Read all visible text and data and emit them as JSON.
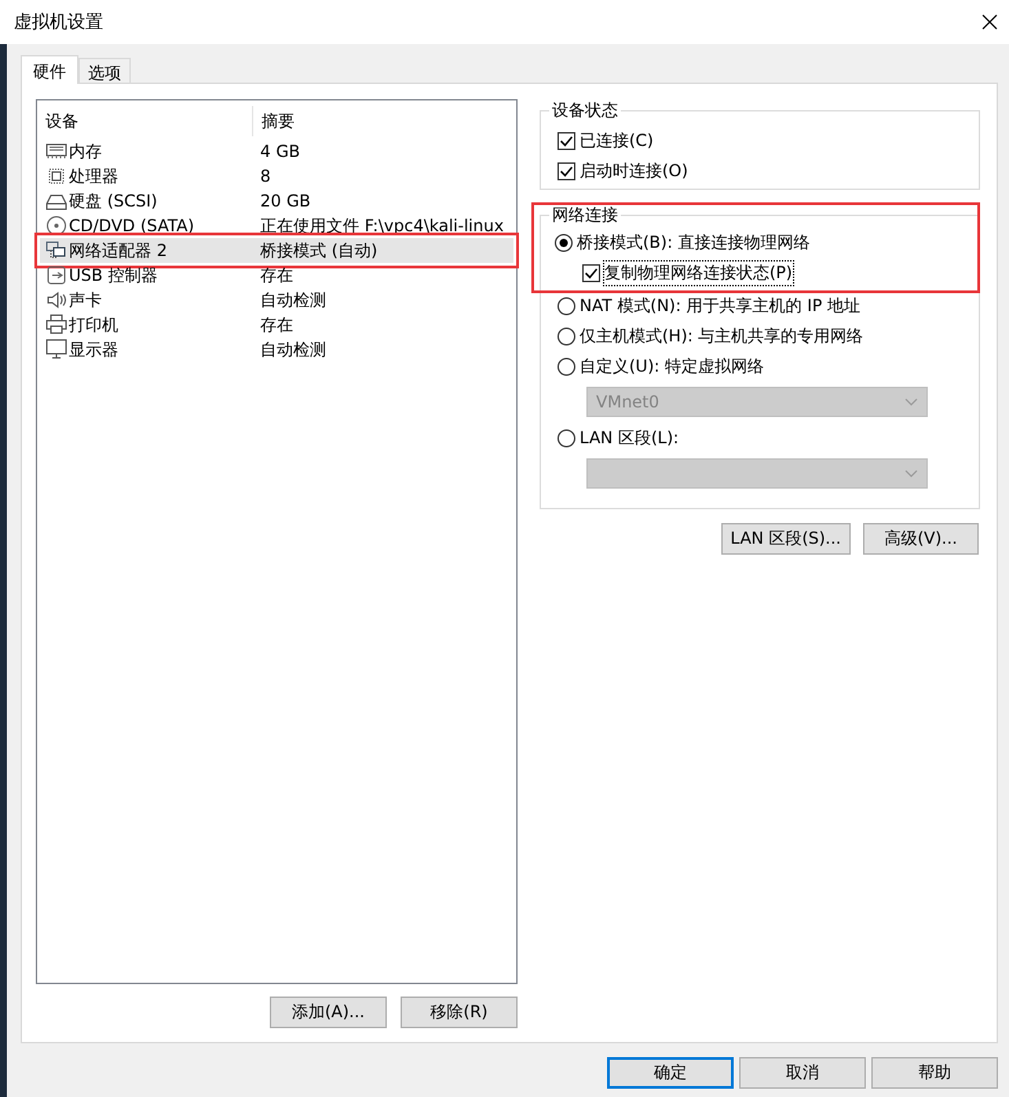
{
  "window": {
    "title": "虚拟机设置"
  },
  "tabs": [
    {
      "label": "硬件",
      "selected": true
    },
    {
      "label": "选项",
      "selected": false
    }
  ],
  "device_table": {
    "columns": [
      "设备",
      "摘要"
    ],
    "rows": [
      {
        "kind": "memory",
        "device": "内存",
        "summary": "4 GB",
        "selected": false,
        "annotated": false
      },
      {
        "kind": "cpu",
        "device": "处理器",
        "summary": "8",
        "selected": false,
        "annotated": false
      },
      {
        "kind": "disk",
        "device": "硬盘 (SCSI)",
        "summary": "20 GB",
        "selected": false,
        "annotated": false
      },
      {
        "kind": "cdrom",
        "device": "CD/DVD (SATA)",
        "summary": "正在使用文件 F:\\vpc4\\kali-linux",
        "selected": false,
        "annotated": false
      },
      {
        "kind": "network",
        "device": "网络适配器 2",
        "summary": "桥接模式 (自动)",
        "selected": true,
        "annotated": true
      },
      {
        "kind": "usb",
        "device": "USB 控制器",
        "summary": "存在",
        "selected": false,
        "annotated": false
      },
      {
        "kind": "sound",
        "device": "声卡",
        "summary": "自动检测",
        "selected": false,
        "annotated": false
      },
      {
        "kind": "printer",
        "device": "打印机",
        "summary": "存在",
        "selected": false,
        "annotated": false
      },
      {
        "kind": "display",
        "device": "显示器",
        "summary": "自动检测",
        "selected": false,
        "annotated": false
      }
    ]
  },
  "device_buttons": [
    "添加(A)...",
    "移除(R)"
  ],
  "device_status": {
    "title": "设备状态",
    "options": [
      {
        "label": "已连接(C)",
        "checked": true
      },
      {
        "label": "启动时连接(O)",
        "checked": true
      }
    ]
  },
  "network_connection": {
    "title": "网络连接",
    "annotated": true,
    "modes": [
      {
        "label": "桥接模式(B): 直接连接物理网络",
        "selected": true,
        "sub_option": {
          "label": "复制物理网络连接状态(P)",
          "checked": true,
          "focused": true
        }
      },
      {
        "label": "NAT 模式(N): 用于共享主机的 IP 地址",
        "selected": false
      },
      {
        "label": "仅主机模式(H): 与主机共享的专用网络",
        "selected": false
      },
      {
        "label": "自定义(U): 特定虚拟网络",
        "selected": false,
        "dropdown": {
          "value": "VMnet0",
          "disabled": true
        }
      },
      {
        "label": "LAN 区段(L):",
        "selected": false,
        "dropdown": {
          "disabled": true
        }
      }
    ]
  },
  "network_buttons": [
    "LAN 区段(S)...",
    "高级(V)..."
  ],
  "dialog_buttons": [
    {
      "label": "确定",
      "default": true
    },
    {
      "label": "取消",
      "default": false
    },
    {
      "label": "帮助",
      "default": false
    }
  ]
}
